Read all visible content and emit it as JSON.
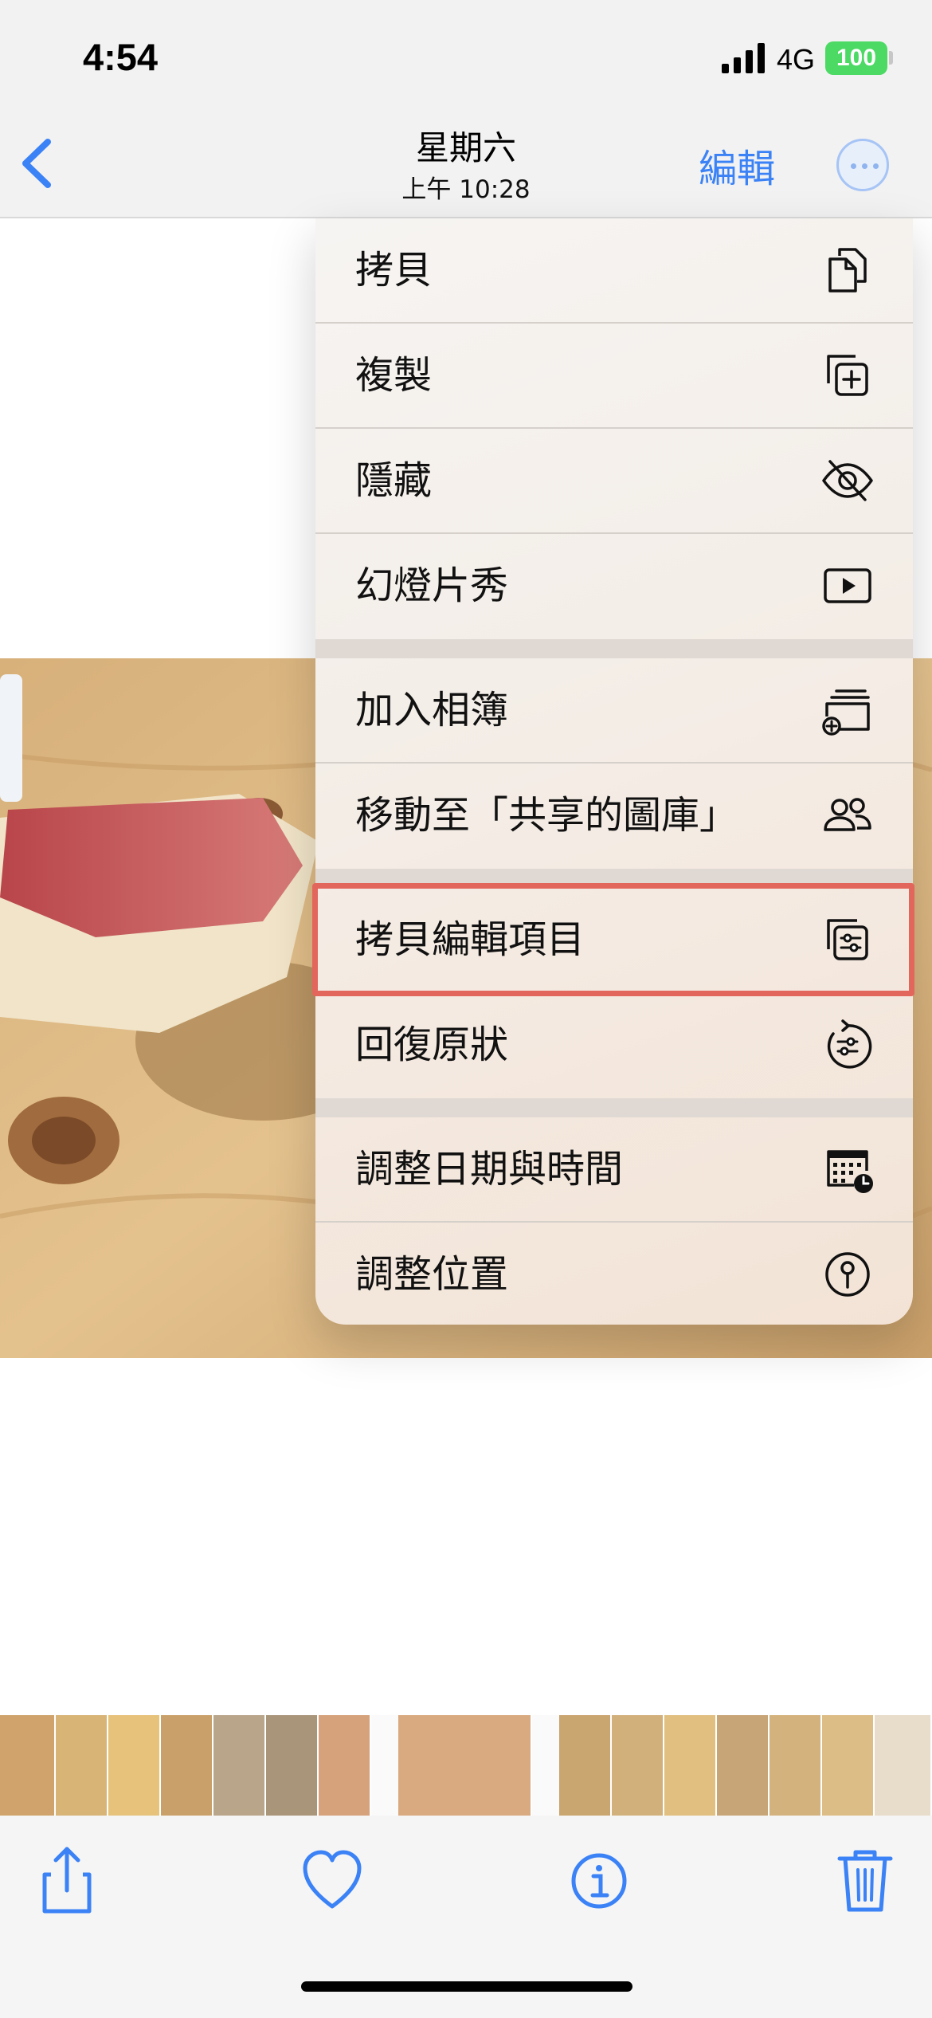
{
  "status_bar": {
    "time": "4:54",
    "network": "4G",
    "battery": "100"
  },
  "nav": {
    "title": "星期六",
    "subtitle": "上午 10:28",
    "edit_label": "編輯",
    "back_icon": "chevron-left-icon",
    "more_icon": "ellipsis-circle-icon"
  },
  "menu": {
    "items": [
      {
        "label": "拷貝",
        "icon": "copy-icon"
      },
      {
        "label": "複製",
        "icon": "duplicate-icon"
      },
      {
        "label": "隱藏",
        "icon": "eye-slash-icon"
      },
      {
        "label": "幻燈片秀",
        "icon": "play-rectangle-icon"
      },
      {
        "label": "加入相簿",
        "icon": "add-to-album-icon"
      },
      {
        "label": "移動至「共享的圖庫」",
        "icon": "people-icon"
      },
      {
        "label": "拷貝編輯項目",
        "icon": "copy-edits-icon"
      },
      {
        "label": "回復原狀",
        "icon": "revert-icon"
      },
      {
        "label": "調整日期與時間",
        "icon": "calendar-clock-icon"
      },
      {
        "label": "調整位置",
        "icon": "location-pin-icon"
      }
    ],
    "highlighted_item": "拷貝編輯項目"
  },
  "toolbar": {
    "share_icon": "share-icon",
    "favorite_icon": "heart-icon",
    "info_icon": "info-icon",
    "delete_icon": "trash-icon"
  },
  "colors": {
    "accent": "#3b82f6",
    "highlight": "#e3665d",
    "battery": "#4cd964"
  }
}
